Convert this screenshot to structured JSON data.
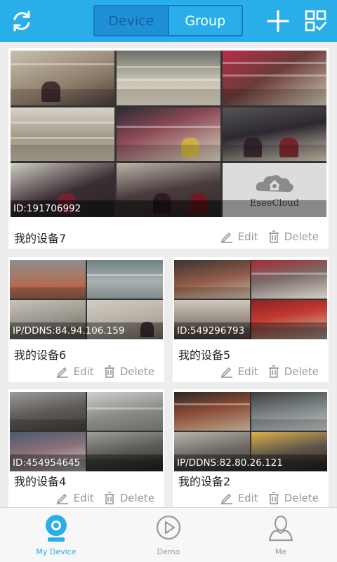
{
  "header": {
    "tabs": [
      {
        "label": "Device",
        "selected": true
      },
      {
        "label": "Group",
        "selected": false
      }
    ],
    "icons": {
      "left": "refresh-icon",
      "add": "add-icon",
      "grid": "grid-check-icon"
    }
  },
  "actions": {
    "edit_label": "Edit",
    "delete_label": "Delete"
  },
  "devices": [
    {
      "name": "我的设备7",
      "id_text": "ID:191706992",
      "channels": 9,
      "cloud_tile_text": "EseeCloud"
    },
    {
      "name": "我的设备6",
      "id_text": "IP/DDNS:84.94.106.159",
      "channels": 4
    },
    {
      "name": "我的设备5",
      "id_text": "ID:549296793",
      "channels": 4
    },
    {
      "name": "我的设备4",
      "id_text": "ID:454954645",
      "channels": 4
    },
    {
      "name": "我的设备2",
      "id_text": "IP/DDNS:82.80.26.121",
      "channels": 4
    }
  ],
  "bottom_nav": [
    {
      "label": "My Device",
      "icon": "camera-icon",
      "active": true
    },
    {
      "label": "Demo",
      "icon": "play-icon",
      "active": false
    },
    {
      "label": "Me",
      "icon": "person-icon",
      "active": false
    }
  ],
  "colors": {
    "header": "#29aee9",
    "segment_selected": "#1f8fd6",
    "segment_border": "#1679c6",
    "nav_active": "#29aee9",
    "nav_inactive": "#9a9a9a"
  }
}
